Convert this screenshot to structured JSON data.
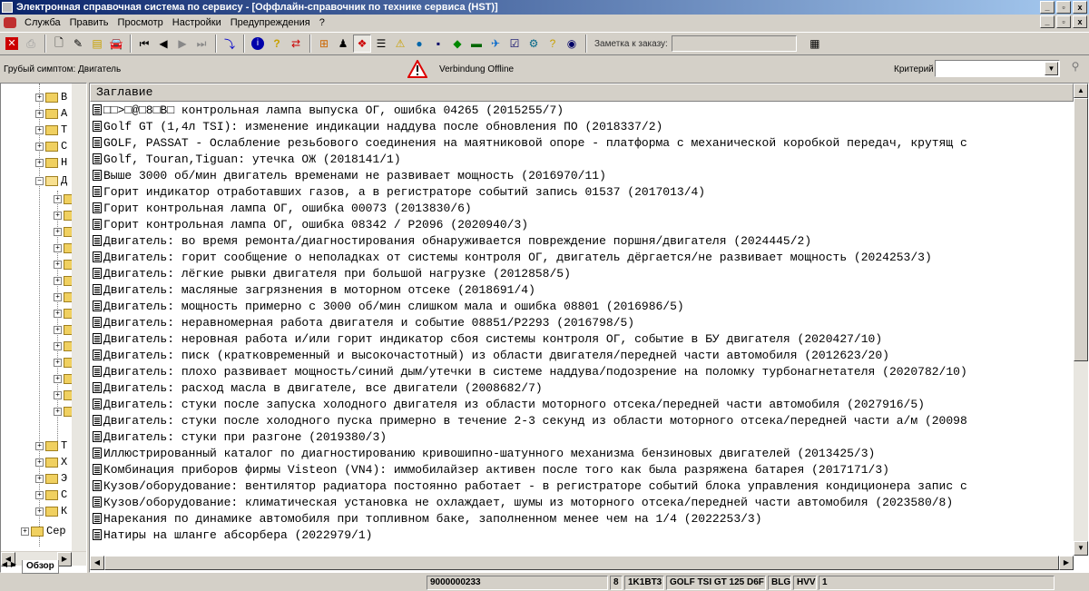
{
  "window": {
    "title": "Электронная справочная система по сервису - [Оффлайн-справочник по технике сервиса (HST)]",
    "controls": [
      "_",
      "▫",
      "x"
    ]
  },
  "menu": [
    {
      "label": "Служба"
    },
    {
      "label": "Править"
    },
    {
      "label": "Просмотр"
    },
    {
      "label": "Настройки"
    },
    {
      "label": "Предупреждения"
    },
    {
      "label": "?"
    }
  ],
  "toolbar": {
    "note_label": "Заметка к заказу:",
    "note_value": ""
  },
  "info": {
    "symptom": "Грубый симптом: Двигатель",
    "connection_status": "Verbindung Offline",
    "criteria_label": "Критерий",
    "criteria_value": ""
  },
  "tree": {
    "items": [
      {
        "label": "В",
        "expanded": false,
        "level": 1
      },
      {
        "label": "А",
        "expanded": false,
        "level": 1
      },
      {
        "label": "Т",
        "expanded": false,
        "level": 1
      },
      {
        "label": "С",
        "expanded": false,
        "level": 1
      },
      {
        "label": "Н",
        "expanded": false,
        "level": 1
      },
      {
        "label": "Д",
        "expanded": true,
        "level": 1
      },
      {
        "label": "",
        "expanded": false,
        "level": 2
      },
      {
        "label": "",
        "expanded": false,
        "level": 2
      },
      {
        "label": "",
        "expanded": false,
        "level": 2
      },
      {
        "label": "",
        "expanded": false,
        "level": 2
      },
      {
        "label": "",
        "expanded": false,
        "level": 2
      },
      {
        "label": "",
        "expanded": false,
        "level": 2
      },
      {
        "label": "",
        "expanded": false,
        "level": 2
      },
      {
        "label": "",
        "expanded": false,
        "level": 2
      },
      {
        "label": "",
        "expanded": false,
        "level": 2
      },
      {
        "label": "",
        "expanded": false,
        "level": 2
      },
      {
        "label": "",
        "expanded": false,
        "level": 2
      },
      {
        "label": "",
        "expanded": false,
        "level": 2
      },
      {
        "label": "",
        "expanded": false,
        "level": 2
      },
      {
        "label": "",
        "expanded": false,
        "level": 2
      },
      {
        "label": "Т",
        "expanded": false,
        "level": 1
      },
      {
        "label": "Х",
        "expanded": false,
        "level": 1
      },
      {
        "label": "Э",
        "expanded": false,
        "level": 1
      },
      {
        "label": "С",
        "expanded": false,
        "level": 1
      },
      {
        "label": "К",
        "expanded": false,
        "level": 1
      },
      {
        "label": "Сер",
        "expanded": false,
        "level": 0
      }
    ],
    "tab_label": "Обзор"
  },
  "list": {
    "header": "Заглавие",
    "rows": [
      "□□>□@□8□В□ контрольная лампа выпуска ОГ, ошибка 04265 (2015255/7)",
      "Golf GT (1,4л TSI): изменение индикации наддува после обновления ПО (2018337/2)",
      "GOLF, PASSAT - Ослабление резьбового соединения на маятниковой опоре - платформа с механической коробкой передач, крутящ с",
      "Golf, Touran,Tiguan: утечка ОЖ (2018141/1)",
      "Выше 3000 об/мин двигатель временами не развивает мощность (2016970/11)",
      "Горит индикатор отработавших газов, а в регистраторе событий запись 01537 (2017013/4)",
      "Горит контрольная лампа ОГ, ошибка 00073 (2013830/6)",
      "Горит контрольная лампа ОГ, ошибка 08342 / P2096 (2020940/3)",
      "Двигатель: во время ремонта/диагностирования обнаруживается повреждение поршня/двигателя (2024445/2)",
      "Двигатель: горит сообщение о неполадках от системы контроля ОГ, двигатель дёргается/не развивает мощность (2024253/3)",
      "Двигатель: лёгкие рывки двигателя при большой нагрузке (2012858/5)",
      "Двигатель: масляные загрязнения в моторном отсеке (2018691/4)",
      "Двигатель: мощность примерно с 3000 об/мин слишком мала и ошибка 08801 (2016986/5)",
      "Двигатель: неравномерная работа двигателя и событие 08851/P2293 (2016798/5)",
      "Двигатель: неровная работа и/или горит индикатор сбоя системы контроля ОГ, событие в БУ двигателя (2020427/10)",
      "Двигатель: писк (кратковременный и высокочастотный) из области двигателя/передней части автомобиля (2012623/20)",
      "Двигатель: плохо развивает мощность/синий дым/утечки в системе наддува/подозрение на поломку турбонагнетателя (2020782/10)",
      "Двигатель: расход масла в двигателе, все двигатели (2008682/7)",
      "Двигатель: стуки после запуска холодного двигателя из области моторного отсека/передней части автомобиля (2027916/5)",
      "Двигатель: стуки после холодного пуска примерно в течение 2-3 секунд из области моторного отсека/передней части а/м (20098",
      "Двигатель: стуки при разгоне (2019380/3)",
      "Иллюстрированный каталог по диагностированию кривошипно-шатунного механизма бензиновых двигателей (2013425/3)",
      "Комбинация приборов фирмы Visteon (VN4): иммобилайзер активен после того как была разряжена батарея (2017171/3)",
      "Кузов/оборудование: вентилятор радиатора постоянно работает - в регистраторе событий блока управления кондиционера запис с",
      "Кузов/оборудование: климатическая установка не охлаждает, шумы из моторного отсека/передней части автомобиля (2023580/8)",
      "Нарекания по динамике автомобиля при топливном баке, заполненном менее чем на 1/4 (2022253/3)",
      "Натиры на шланге абсорбера (2022979/1)"
    ]
  },
  "status": {
    "order_number": "9000000233",
    "field_8": "8",
    "engine_code": "1K1BT3",
    "model": "GOLF TSI GT 125 D6F",
    "field_blg": "BLG",
    "field_hvv": "HVV",
    "page": "1"
  }
}
